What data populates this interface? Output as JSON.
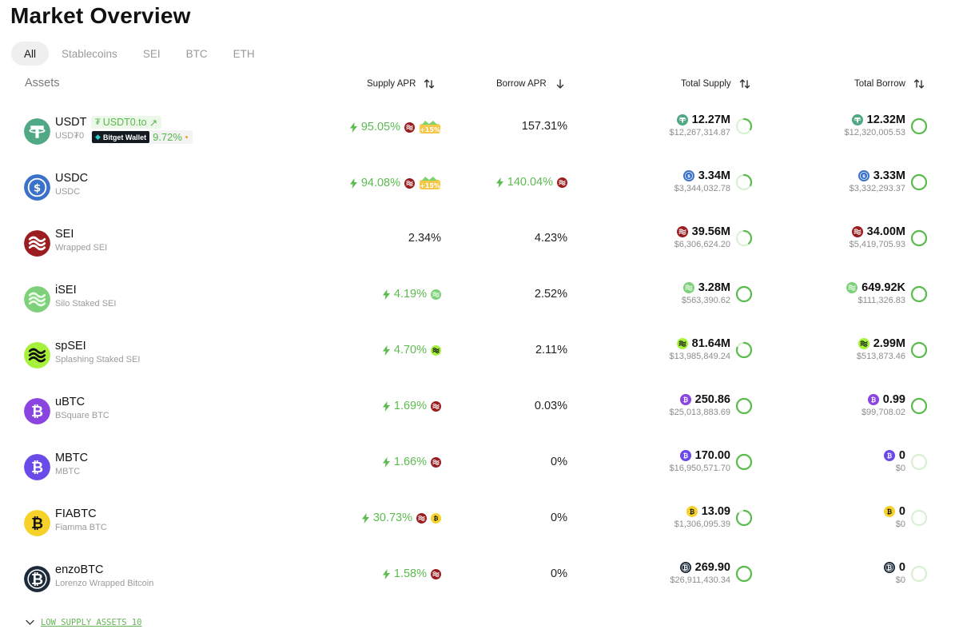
{
  "page_title": "Market Overview",
  "tabs": [
    "All",
    "Stablecoins",
    "SEI",
    "BTC",
    "ETH"
  ],
  "active_tab": "All",
  "headers": {
    "assets": "Assets",
    "supply_apr": "Supply APR",
    "borrow_apr": "Borrow APR",
    "total_supply": "Total Supply",
    "total_borrow": "Total Borrow"
  },
  "colors": {
    "green": "#5cbb4f",
    "ring_light": "#d9f0d4",
    "usdt": "#50a884",
    "usdc": "#3a72c9",
    "sei": "#9b1d20",
    "isei": "#7fd07a",
    "spsei": "#a6f23a",
    "ubtc": "#8a44e0",
    "mbtc": "#6a4ae8",
    "fiabtc": "#f5d12a",
    "enzobtc": "#1c2a3a"
  },
  "assets": [
    {
      "symbol": "USDT",
      "name": "USD₮0",
      "icon": "tether-icon",
      "link_badge": "USDT0.to",
      "wallet_badge": "Bitget Wallet",
      "wallet_apr": "9.72",
      "supply_apr": "95.05%",
      "supply_boost": true,
      "supply_icons": [
        "sei-icon",
        "promo-15-icon"
      ],
      "borrow_apr": "157.31%",
      "borrow_boost": false,
      "borrow_icons": [],
      "total_supply": "12.27M",
      "total_supply_usd": "$12,267,314.87",
      "supply_util": 0.32,
      "total_borrow": "12.32M",
      "total_borrow_usd": "$12,320,005.53",
      "borrow_util": 1.0
    },
    {
      "symbol": "USDC",
      "name": "USDC",
      "icon": "usdc-icon",
      "supply_apr": "94.08%",
      "supply_boost": true,
      "supply_icons": [
        "sei-icon",
        "promo-15-icon"
      ],
      "borrow_apr": "140.04%",
      "borrow_boost": true,
      "borrow_icons": [
        "sei-icon"
      ],
      "total_supply": "3.34M",
      "total_supply_usd": "$3,344,032.78",
      "supply_util": 0.32,
      "total_borrow": "3.33M",
      "total_borrow_usd": "$3,332,293.37",
      "borrow_util": 1.0
    },
    {
      "symbol": "SEI",
      "name": "Wrapped SEI",
      "icon": "sei-icon",
      "supply_apr": "2.34%",
      "supply_boost": false,
      "supply_icons": [],
      "borrow_apr": "4.23%",
      "borrow_boost": false,
      "borrow_icons": [],
      "total_supply": "39.56M",
      "total_supply_usd": "$6,306,624.20",
      "supply_util": 0.38,
      "total_borrow": "34.00M",
      "total_borrow_usd": "$5,419,705.93",
      "borrow_util": 1.0
    },
    {
      "symbol": "iSEI",
      "name": "Silo Staked SEI",
      "icon": "isei-icon",
      "supply_apr": "4.19%",
      "supply_boost": true,
      "supply_icons": [
        "isei-icon"
      ],
      "borrow_apr": "2.52%",
      "borrow_boost": false,
      "borrow_icons": [],
      "total_supply": "3.28M",
      "total_supply_usd": "$563,390.62",
      "supply_util": 1.0,
      "total_borrow": "649.92K",
      "total_borrow_usd": "$111,326.83",
      "borrow_util": 1.0
    },
    {
      "symbol": "spSEI",
      "name": "Splashing Staked SEI",
      "icon": "spsei-icon",
      "supply_apr": "4.70%",
      "supply_boost": true,
      "supply_icons": [
        "spsei-icon"
      ],
      "borrow_apr": "2.11%",
      "borrow_boost": false,
      "borrow_icons": [],
      "total_supply": "81.64M",
      "total_supply_usd": "$13,985,849.24",
      "supply_util": 0.8,
      "total_borrow": "2.99M",
      "total_borrow_usd": "$513,873.46",
      "borrow_util": 1.0
    },
    {
      "symbol": "uBTC",
      "name": "BSquare BTC",
      "icon": "ubtc-icon",
      "supply_apr": "1.69%",
      "supply_boost": true,
      "supply_icons": [
        "sei-icon"
      ],
      "borrow_apr": "0.03%",
      "borrow_boost": false,
      "borrow_icons": [],
      "total_supply": "250.86",
      "total_supply_usd": "$25,013,883.69",
      "supply_util": 1.0,
      "total_borrow": "0.99",
      "total_borrow_usd": "$99,708.02",
      "borrow_util": 1.0
    },
    {
      "symbol": "MBTC",
      "name": "MBTC",
      "icon": "mbtc-icon",
      "supply_apr": "1.66%",
      "supply_boost": true,
      "supply_icons": [
        "sei-icon"
      ],
      "borrow_apr": "0%",
      "borrow_boost": false,
      "borrow_icons": [],
      "total_supply": "170.00",
      "total_supply_usd": "$16,950,571.70",
      "supply_util": 1.0,
      "total_borrow": "0",
      "total_borrow_usd": "$0",
      "borrow_util": 0
    },
    {
      "symbol": "FIABTC",
      "name": "Fiamma BTC",
      "icon": "fiabtc-icon",
      "supply_apr": "30.73%",
      "supply_boost": true,
      "supply_icons": [
        "sei-icon",
        "fiabtc-icon"
      ],
      "borrow_apr": "0%",
      "borrow_boost": false,
      "borrow_icons": [],
      "total_supply": "13.09",
      "total_supply_usd": "$1,306,095.39",
      "supply_util": 0.85,
      "total_borrow": "0",
      "total_borrow_usd": "$0",
      "borrow_util": 0
    },
    {
      "symbol": "enzoBTC",
      "name": "Lorenzo Wrapped Bitcoin",
      "icon": "enzobtc-icon",
      "supply_apr": "1.58%",
      "supply_boost": true,
      "supply_icons": [
        "sei-icon"
      ],
      "borrow_apr": "0%",
      "borrow_boost": false,
      "borrow_icons": [],
      "total_supply": "269.90",
      "total_supply_usd": "$26,911,430.34",
      "supply_util": 1.0,
      "total_borrow": "0",
      "total_borrow_usd": "$0",
      "borrow_util": 0
    }
  ],
  "low_supply_link": "LOW SUPPLY ASSETS 10"
}
